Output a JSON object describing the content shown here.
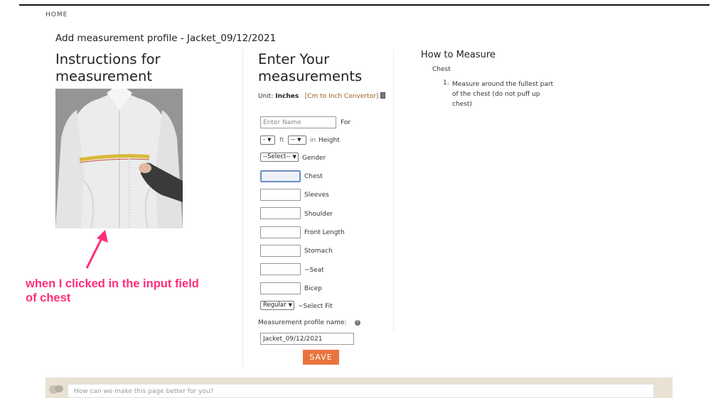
{
  "nav": {
    "home": "HOME"
  },
  "page": {
    "title": "Add measurement profile - Jacket_09/12/2021"
  },
  "instructions": {
    "heading": "Instructions for measurement"
  },
  "annotation": {
    "text": "when I clicked in the input field of chest",
    "color": "#ff2e7a"
  },
  "form": {
    "heading": "Enter Your measurements",
    "unit_label": "Unit:",
    "unit_value": "Inches",
    "convertor_link": "[Cm to Inch Convertor]",
    "name_placeholder": "Enter Name",
    "for_label": "For",
    "height": {
      "ft_value": "-",
      "ft_label": "ft",
      "in_value": "--",
      "in_label": "in",
      "label": "Height"
    },
    "gender": {
      "value": "--Select--",
      "label": "Gender"
    },
    "fields": [
      {
        "label": "Chest",
        "value": ""
      },
      {
        "label": "Sleeves",
        "value": ""
      },
      {
        "label": "Shoulder",
        "value": ""
      },
      {
        "label": "Front Length",
        "value": ""
      },
      {
        "label": "Stomach",
        "value": ""
      },
      {
        "label": "~Seat",
        "value": ""
      },
      {
        "label": "Bicep",
        "value": ""
      }
    ],
    "fit": {
      "value": "Regular",
      "label": "~Select Fit"
    },
    "profile_name_label": "Measurement profile name:",
    "profile_name_value": "Jacket_09/12/2021",
    "save": "SAVE",
    "accent_color": "#e8743b"
  },
  "how_to": {
    "title": "How to Measure",
    "subtitle": "Chest",
    "step_number": "1.",
    "step_text": "Measure around the fullest part of the chest (do not puff up chest)"
  },
  "feedback": {
    "placeholder": "How can we make this page better for you?"
  }
}
